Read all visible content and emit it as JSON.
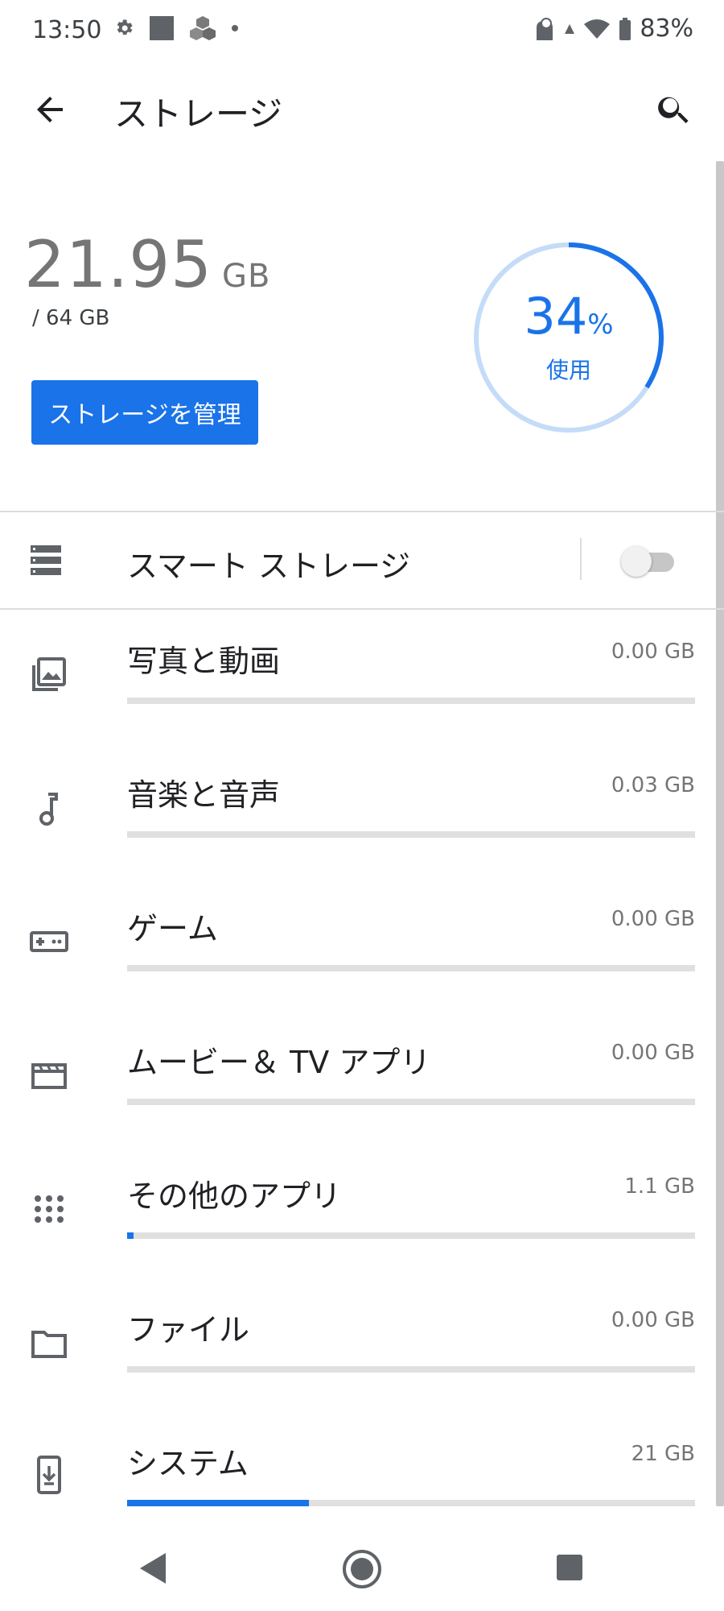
{
  "status_bar": {
    "time": "13:50",
    "battery": "83%"
  },
  "app_bar": {
    "title": "ストレージ"
  },
  "summary": {
    "used_value": "21.95",
    "used_unit": "GB",
    "total": "/ 64 GB",
    "percent": "34",
    "percent_sign": "%",
    "percent_label": "使用",
    "manage_button": "ストレージを管理"
  },
  "smart_storage": {
    "label": "スマート ストレージ",
    "enabled": false
  },
  "categories": [
    {
      "label": "写真と動画",
      "size": "0.00 GB",
      "icon": "photo-icon",
      "fraction": 0.0
    },
    {
      "label": "音楽と音声",
      "size": "0.03 GB",
      "icon": "music-note-icon",
      "fraction": 0.0
    },
    {
      "label": "ゲーム",
      "size": "0.00 GB",
      "icon": "gamepad-icon",
      "fraction": 0.0
    },
    {
      "label": "ムービー＆ TV アプリ",
      "size": "0.00 GB",
      "icon": "movie-clapper-icon",
      "fraction": 0.0
    },
    {
      "label": "その他のアプリ",
      "size": "1.1 GB",
      "icon": "apps-grid-icon",
      "fraction": 0.01
    },
    {
      "label": "ファイル",
      "size": "0.00 GB",
      "icon": "folder-icon",
      "fraction": 0.0
    },
    {
      "label": "システム",
      "size": "21 GB",
      "icon": "system-update-icon",
      "fraction": 0.32
    }
  ],
  "colors": {
    "accent": "#1a73e8",
    "accent_light": "#c4dcf8",
    "track": "#e0e0e0",
    "text_secondary": "#757575"
  }
}
